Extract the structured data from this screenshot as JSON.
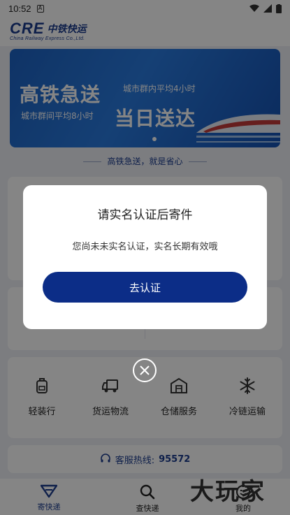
{
  "status_bar": {
    "time": "10:52",
    "sim_glyph": "A"
  },
  "header": {
    "logo_mark": "CRE",
    "logo_cn": "中铁快运",
    "logo_en": "China Railway Express Co.,Ltd."
  },
  "banner": {
    "headline_1": "高铁急送",
    "subline_1": "城市群内平均4小时",
    "subline_2": "城市群间平均8小时",
    "headline_2": "当日送达"
  },
  "slogan": "高铁急送，就是省心",
  "services": [
    {
      "label": "轻装行",
      "icon": "backpack-icon"
    },
    {
      "label": "货运物流",
      "icon": "truck-icon"
    },
    {
      "label": "仓储服务",
      "icon": "warehouse-icon"
    },
    {
      "label": "冷链运输",
      "icon": "snowflake-icon"
    }
  ],
  "hotline": {
    "label": "客服热线:",
    "number": "95572"
  },
  "bottom_nav": [
    {
      "label": "寄快递",
      "active": true
    },
    {
      "label": "查快递",
      "active": false
    },
    {
      "label": "我的",
      "active": false
    }
  ],
  "watermark": "大玩家",
  "dialog": {
    "title": "请实名认证后寄件",
    "message": "您尚未未实名认证，实名长期有效哦",
    "button": "去认证"
  },
  "colors": {
    "brand": "#1b3c8f",
    "button": "#0c2d87",
    "overlay": "rgba(0,0,0,0.48)"
  }
}
